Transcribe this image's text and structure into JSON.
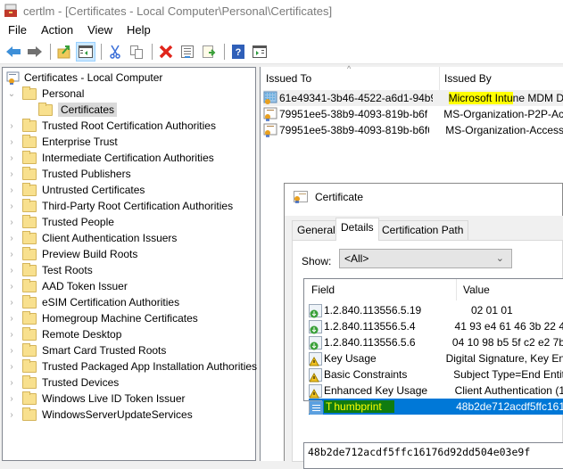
{
  "window": {
    "title": "certlm - [Certificates - Local Computer\\Personal\\Certificates]",
    "icon": "certlm-toolbox-icon"
  },
  "menu": [
    "File",
    "Action",
    "View",
    "Help"
  ],
  "toolbar": [
    {
      "icon": "back-arrow-icon"
    },
    {
      "icon": "forward-arrow-icon"
    },
    {
      "icon": "up-folder-icon"
    },
    {
      "icon": "show-hide-tree-icon",
      "active": true
    },
    {
      "icon": "cut-icon"
    },
    {
      "icon": "copy-icon"
    },
    {
      "icon": "delete-icon"
    },
    {
      "icon": "properties-icon"
    },
    {
      "icon": "export-list-icon"
    },
    {
      "icon": "help-icon"
    },
    {
      "icon": "show-action-pane-icon"
    }
  ],
  "tree": {
    "root": "Certificates - Local Computer",
    "personal": "Personal",
    "selected": "Certificates",
    "items": [
      "Trusted Root Certification Authorities",
      "Enterprise Trust",
      "Intermediate Certification Authorities",
      "Trusted Publishers",
      "Untrusted Certificates",
      "Third-Party Root Certification Authorities",
      "Trusted People",
      "Client Authentication Issuers",
      "Preview Build Roots",
      "Test Roots",
      "AAD Token Issuer",
      "eSIM Certification Authorities",
      "Homegroup Machine Certificates",
      "Remote Desktop",
      "Smart Card Trusted Roots",
      "Trusted Packaged App Installation Authorities",
      "Trusted Devices",
      "Windows Live ID Token Issuer",
      "WindowsServerUpdateServices"
    ]
  },
  "list": {
    "columns": [
      "Issued To",
      "Issued By"
    ],
    "rows": [
      {
        "issued_to": "61e49341-3b46-4522-a6d1-94b9...",
        "issued_by_hl": "Microsoft Intu",
        "issued_by_rest": "ne MDM D"
      },
      {
        "issued_to": "79951ee5-38b9-4093-819b-b6f6...",
        "issued_by_hl": "",
        "issued_by_rest": "MS-Organization-P2P-Ac"
      },
      {
        "issued_to": "79951ee5-38b9-4093-819b-b6f6...",
        "issued_by_hl": "",
        "issued_by_rest": "MS-Organization-Access"
      }
    ]
  },
  "dialog": {
    "title": "Certificate",
    "tabs": [
      "General",
      "Details",
      "Certification Path"
    ],
    "active_tab": "Details",
    "show_label": "Show:",
    "show_value": "<All>",
    "field_columns": [
      "Field",
      "Value"
    ],
    "fields": [
      {
        "name": "1.2.840.113556.5.19",
        "value": "02 01 01",
        "icon": "extension-download-icon"
      },
      {
        "name": "1.2.840.113556.5.4",
        "value": "41 93 e4 61 46 3b 22 4",
        "icon": "extension-download-icon"
      },
      {
        "name": "1.2.840.113556.5.6",
        "value": "04 10 98 b5 5f c2 e2 7b",
        "icon": "extension-download-icon"
      },
      {
        "name": "Key Usage",
        "value": "Digital Signature, Key En",
        "icon": "critical-extension-warning-icon"
      },
      {
        "name": "Basic Constraints",
        "value": "Subject Type=End Entit",
        "icon": "critical-extension-warning-icon"
      },
      {
        "name": "Enhanced Key Usage",
        "value": "Client Authentication (1",
        "icon": "critical-extension-warning-icon"
      },
      {
        "name": "Thumbprint",
        "name_first": "T",
        "name_hl": "humbprint",
        "value": "48b2de712acdf5ffc161",
        "icon": "property-icon",
        "selected": true
      }
    ],
    "detail_value": "48b2de712acdf5ffc16176d92dd504e03e9f"
  }
}
